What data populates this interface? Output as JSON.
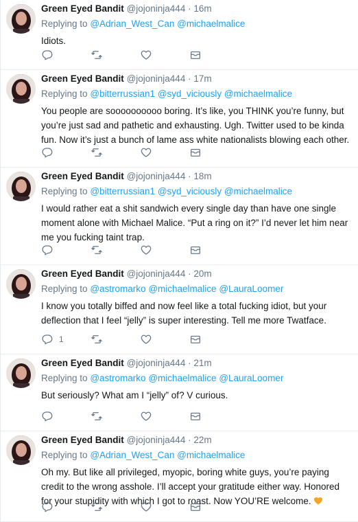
{
  "colors": {
    "mention": "#1da1f2",
    "secondary_text": "#657786",
    "primary_text": "#14171a",
    "divider": "#e6ecf0",
    "heart_emoji": "#f4a62a"
  },
  "icons": {
    "reply": "reply-icon",
    "retweet": "retweet-icon",
    "like": "heart-icon",
    "dm": "envelope-icon"
  },
  "tweets": [
    {
      "name": "Green Eyed Bandit",
      "handle": "@jojoninja444",
      "dot": "·",
      "time": "16m",
      "replying_prefix": "Replying to",
      "mentions": [
        "@Adrian_West_Can",
        "@michaelmalice"
      ],
      "text": "Idiots.",
      "reply_count": ""
    },
    {
      "name": "Green Eyed Bandit",
      "handle": "@jojoninja444",
      "dot": "·",
      "time": "17m",
      "replying_prefix": "Replying to",
      "mentions": [
        "@bitterrussian1",
        "@syd_viciously",
        "@michaelmalice"
      ],
      "text": "You people are soooooooooo boring. It’s like, you THINK you’re funny, but you’re just sad and pathetic and exhausting. Ugh. Twitter used to be kinda fun. Now it’s just a bunch of lame ass white nationalists blowing each other.",
      "reply_count": ""
    },
    {
      "name": "Green Eyed Bandit",
      "handle": "@jojoninja444",
      "dot": "·",
      "time": "18m",
      "replying_prefix": "Replying to",
      "mentions": [
        "@bitterrussian1",
        "@syd_viciously",
        "@michaelmalice"
      ],
      "text": "I would rather eat a shit sandwich every single day than have one single moment alone with Michael Malice. “Put a ring on it?” I’d never let him near me you fucking taint trap.",
      "reply_count": ""
    },
    {
      "name": "Green Eyed Bandit",
      "handle": "@jojoninja444",
      "dot": "·",
      "time": "20m",
      "replying_prefix": "Replying to",
      "mentions": [
        "@astromarko",
        "@michaelmalice",
        "@LauraLoomer"
      ],
      "text": "I know you totally biffed and now feel like a total fucking idiot, but your deflection that I feel “jelly” is super interesting. Tell me more Twatface.",
      "reply_count": "1"
    },
    {
      "name": "Green Eyed Bandit",
      "handle": "@jojoninja444",
      "dot": "·",
      "time": "21m",
      "replying_prefix": "Replying to",
      "mentions": [
        "@astromarko",
        "@michaelmalice",
        "@LauraLoomer"
      ],
      "text": "But seriously? What am I “jelly” of? V curious.",
      "reply_count": ""
    },
    {
      "name": "Green Eyed Bandit",
      "handle": "@jojoninja444",
      "dot": "·",
      "time": "22m",
      "replying_prefix": "Replying to",
      "mentions": [
        "@Adrian_West_Can",
        "@michaelmalice"
      ],
      "text": "Oh my. But like all privileged, myopic, boring white guys, you’re paying credit to the wrong asshole. I’ll accept your gratitude either way. Honored for your stupidity with which I got to roast. Now YOU’RE welcome. ",
      "emoji": "orange-heart-emoji",
      "reply_count": ""
    }
  ]
}
